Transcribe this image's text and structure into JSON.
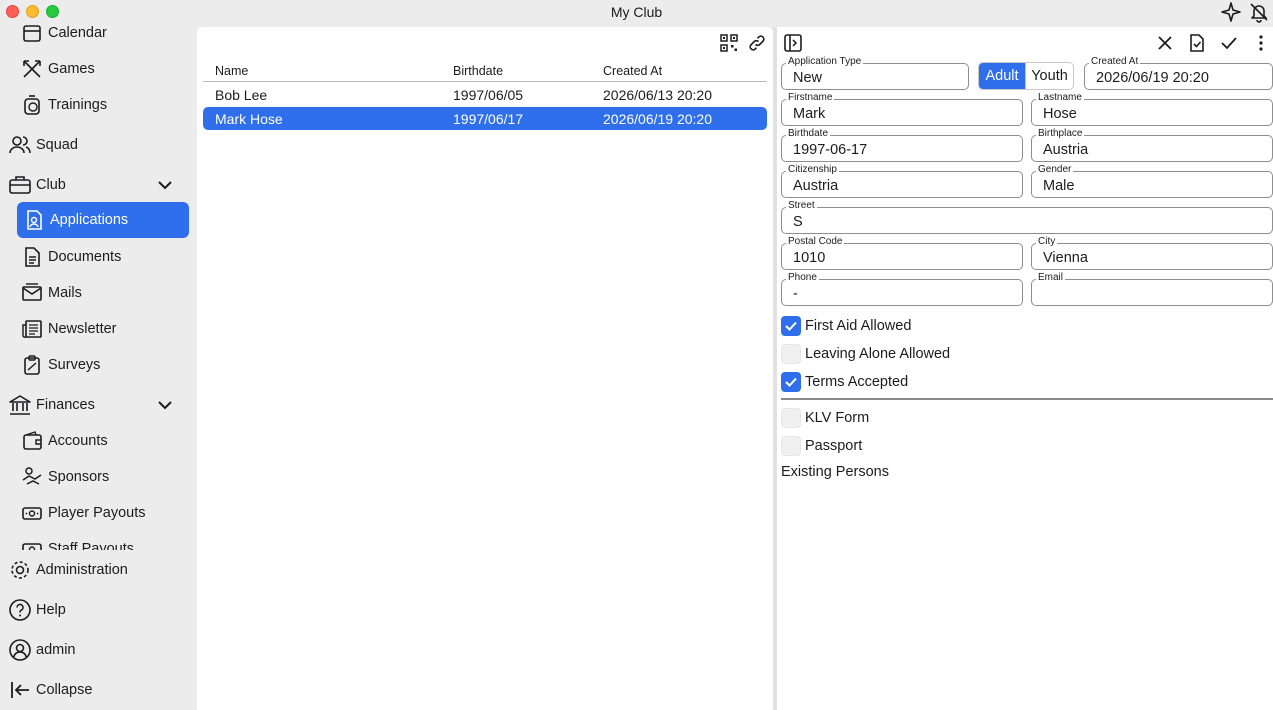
{
  "window": {
    "title": "My Club"
  },
  "sidebar": {
    "items": [
      {
        "label": "Calendar",
        "icon": "calendar-icon"
      },
      {
        "label": "Games",
        "icon": "games-icon"
      },
      {
        "label": "Trainings",
        "icon": "stopwatch-icon"
      },
      {
        "label": "Squad",
        "icon": "people-icon"
      },
      {
        "label": "Club",
        "icon": "briefcase-icon"
      },
      {
        "label": "Applications",
        "icon": "person-document-icon"
      },
      {
        "label": "Documents",
        "icon": "document-icon"
      },
      {
        "label": "Mails",
        "icon": "mail-icon"
      },
      {
        "label": "Newsletter",
        "icon": "newspaper-icon"
      },
      {
        "label": "Surveys",
        "icon": "clipboard-icon"
      },
      {
        "label": "Finances",
        "icon": "bank-icon"
      },
      {
        "label": "Accounts",
        "icon": "wallet-icon"
      },
      {
        "label": "Sponsors",
        "icon": "handshake-icon"
      },
      {
        "label": "Player Payouts",
        "icon": "banknote-icon"
      },
      {
        "label": "Staff Payouts",
        "icon": "banknote-icon"
      }
    ],
    "bottom": [
      {
        "label": "Administration",
        "icon": "gear-icon"
      },
      {
        "label": "Help",
        "icon": "help-icon"
      },
      {
        "label": "admin",
        "icon": "user-circle-icon"
      },
      {
        "label": "Collapse",
        "icon": "collapse-icon"
      }
    ]
  },
  "list": {
    "columns": [
      "Name",
      "Birthdate",
      "Created At"
    ],
    "rows": [
      {
        "name": "Bob Lee",
        "birthdate": "1997/06/05",
        "created": "2026/06/13 20:20"
      },
      {
        "name": "Mark Hose",
        "birthdate": "1997/06/17",
        "created": "2026/06/19 20:20"
      }
    ]
  },
  "detail": {
    "application_type": {
      "label": "Application Type",
      "value": "New"
    },
    "segment": {
      "options": [
        "Adult",
        "Youth"
      ],
      "selected": "Adult"
    },
    "created_at": {
      "label": "Created At",
      "value": "2026/06/19 20:20"
    },
    "firstname": {
      "label": "Firstname",
      "value": "Mark"
    },
    "lastname": {
      "label": "Lastname",
      "value": "Hose"
    },
    "birthdate": {
      "label": "Birthdate",
      "value": "1997-06-17"
    },
    "birthplace": {
      "label": "Birthplace",
      "value": "Austria"
    },
    "citizenship": {
      "label": "Citizenship",
      "value": "Austria"
    },
    "gender": {
      "label": "Gender",
      "value": "Male"
    },
    "street": {
      "label": "Street",
      "value": "S"
    },
    "postal_code": {
      "label": "Postal Code",
      "value": "1010"
    },
    "city": {
      "label": "City",
      "value": "Vienna"
    },
    "phone": {
      "label": "Phone",
      "value": "-"
    },
    "email": {
      "label": "Email",
      "value": ""
    },
    "checks": [
      {
        "label": "First Aid Allowed",
        "checked": true
      },
      {
        "label": "Leaving Alone Allowed",
        "checked": false
      },
      {
        "label": "Terms Accepted",
        "checked": true
      },
      {
        "label": "KLV Form",
        "checked": false
      },
      {
        "label": "Passport",
        "checked": false
      }
    ],
    "existing_label": "Existing Persons"
  },
  "colors": {
    "accent": "#2f6feb",
    "sidebar_bg": "#ececec"
  }
}
